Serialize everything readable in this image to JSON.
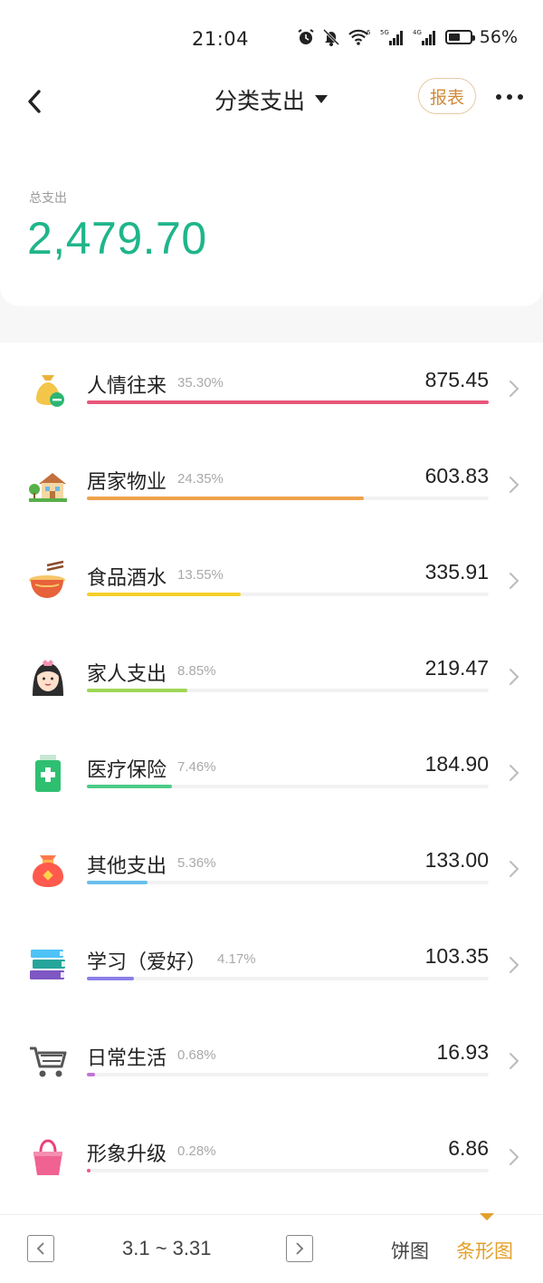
{
  "status_bar": {
    "time": "21:04",
    "battery_percent": "56%",
    "battery_level": 0.56,
    "icons": [
      "alarm-icon",
      "bell-off-icon",
      "wifi-6-icon",
      "signal-5g-icon",
      "signal-4g-icon",
      "battery-icon"
    ],
    "net_5g": "5G",
    "net_4g": "4G",
    "wifi_6": "6"
  },
  "header": {
    "title": "分类支出",
    "report_label": "报表"
  },
  "summary": {
    "label": "总支出",
    "amount": "2,479.70",
    "accent_color": "#1fb58a"
  },
  "categories": [
    {
      "name": "人情往来",
      "percent": "35.30%",
      "amount": "875.45",
      "share": 0.353,
      "color": "#e8577a",
      "icon": "money-bag-icon"
    },
    {
      "name": "居家物业",
      "percent": "24.35%",
      "amount": "603.83",
      "share": 0.2435,
      "color": "#f0a24b",
      "icon": "house-icon"
    },
    {
      "name": "食品酒水",
      "percent": "13.55%",
      "amount": "335.91",
      "share": 0.1355,
      "color": "#f6cf2c",
      "icon": "noodle-bowl-icon"
    },
    {
      "name": "家人支出",
      "percent": "8.85%",
      "amount": "219.47",
      "share": 0.0885,
      "color": "#9fd657",
      "icon": "family-girl-icon"
    },
    {
      "name": "医疗保险",
      "percent": "7.46%",
      "amount": "184.90",
      "share": 0.0746,
      "color": "#4ccb86",
      "icon": "medicine-bottle-icon"
    },
    {
      "name": "其他支出",
      "percent": "5.36%",
      "amount": "133.00",
      "share": 0.0536,
      "color": "#6bbfee",
      "icon": "red-pouch-icon"
    },
    {
      "name": "学习（爱好）",
      "percent": "4.17%",
      "amount": "103.35",
      "share": 0.0417,
      "color": "#8b7fe8",
      "icon": "books-icon"
    },
    {
      "name": "日常生活",
      "percent": "0.68%",
      "amount": "16.93",
      "share": 0.0068,
      "color": "#c074d6",
      "icon": "shopping-cart-icon"
    },
    {
      "name": "形象升级",
      "percent": "0.28%",
      "amount": "6.86",
      "share": 0.0028,
      "color": "#ee5a86",
      "icon": "handbag-icon"
    }
  ],
  "footer": {
    "date_range": "3.1 ~ 3.31",
    "tab_pie": "饼图",
    "tab_bar": "条形图",
    "active_tab": "条形图",
    "active_color": "#e3a02b"
  }
}
